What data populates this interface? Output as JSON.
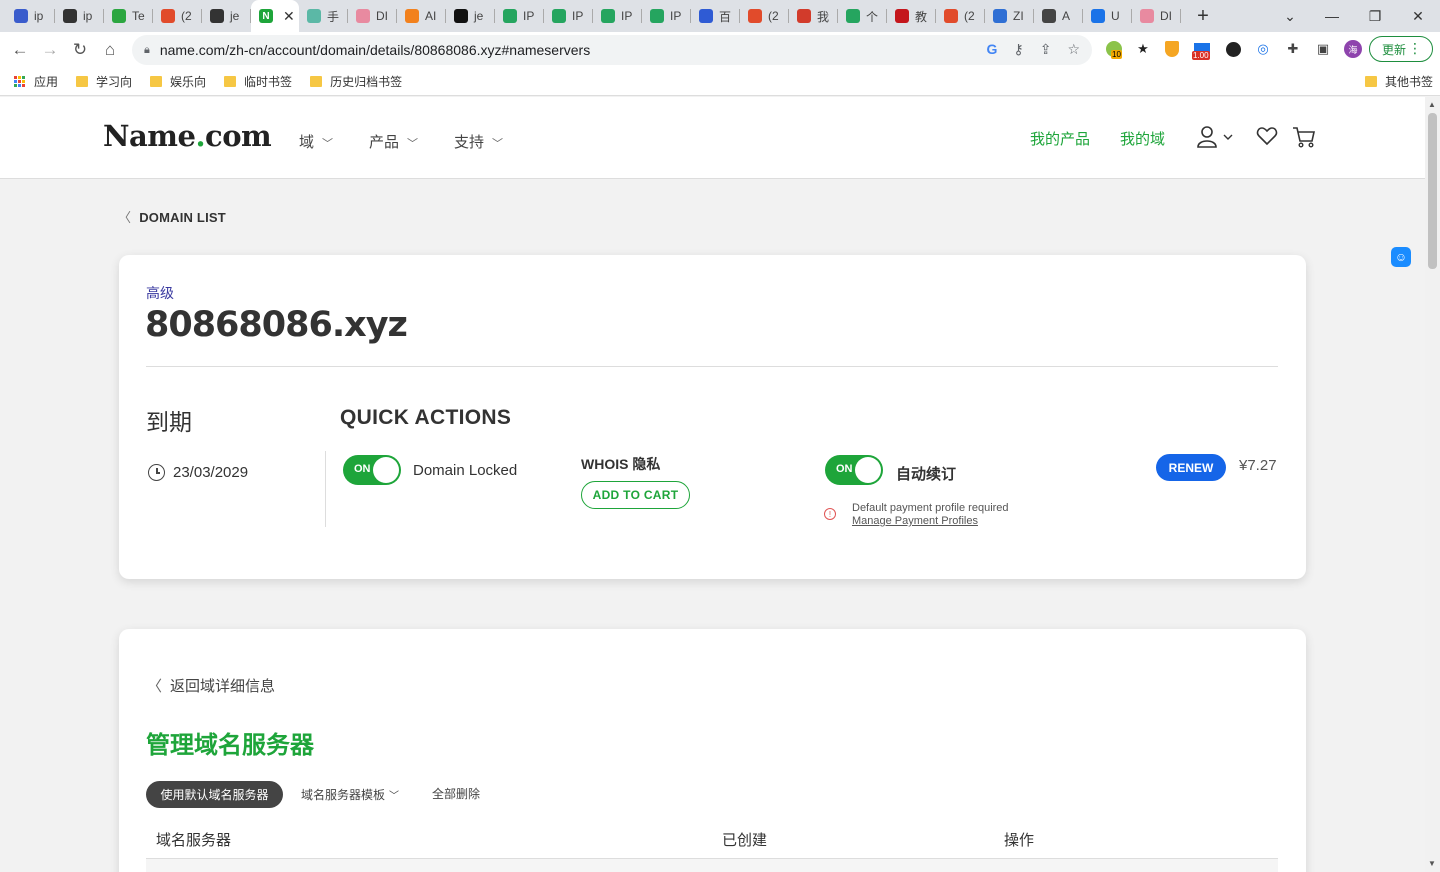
{
  "browser": {
    "tabs": [
      {
        "label": "ip",
        "color": "#3a5ccc"
      },
      {
        "label": "ip",
        "color": "#333333"
      },
      {
        "label": "Te",
        "color": "#2ba640"
      },
      {
        "label": "(2",
        "color": "#e14b2b"
      },
      {
        "label": "je",
        "color": "#333333"
      },
      {
        "label": "",
        "color": "#1ea53a",
        "active": true
      },
      {
        "label": "手",
        "color": "#5bb8a6"
      },
      {
        "label": "DI",
        "color": "#e88aa0"
      },
      {
        "label": "AI",
        "color": "#f2811d"
      },
      {
        "label": "je",
        "color": "#111111"
      },
      {
        "label": "IP",
        "color": "#25a55f"
      },
      {
        "label": "IP",
        "color": "#25a55f"
      },
      {
        "label": "IP",
        "color": "#25a55f"
      },
      {
        "label": "IP",
        "color": "#25a55f"
      },
      {
        "label": "百",
        "color": "#2f5bd4"
      },
      {
        "label": "(2",
        "color": "#e14b2b"
      },
      {
        "label": "我",
        "color": "#d23b2b"
      },
      {
        "label": "个",
        "color": "#25a55f"
      },
      {
        "label": "教",
        "color": "#c4161c"
      },
      {
        "label": "(2",
        "color": "#e14b2b"
      },
      {
        "label": "ZI",
        "color": "#2f6fd4"
      },
      {
        "label": "A",
        "color": "#444444"
      },
      {
        "label": "U",
        "color": "#1a73e8"
      },
      {
        "label": "DI",
        "color": "#e88aa0"
      }
    ],
    "active_tab_icon": "N",
    "close_symbol": "✕",
    "new_tab_symbol": "+",
    "window_controls": {
      "dropdown": "⌄",
      "minimize": "—",
      "restore": "❐",
      "close": "✕"
    },
    "url": "name.com/zh-cn/account/domain/details/80868086.xyz#nameservers",
    "update_button": "更新",
    "extension_badges": {
      "mail": "10",
      "price": "1.00"
    },
    "profile_initial": "海"
  },
  "bookmarks": {
    "apps": "应用",
    "items": [
      "学习向",
      "娱乐向",
      "临时书签",
      "历史归档书签"
    ],
    "other": "其他书签"
  },
  "site": {
    "logo_main": "Name",
    "logo_dot": ".",
    "logo_tld": "com",
    "nav": [
      "域",
      "产品",
      "支持"
    ],
    "my_products": "我的产品",
    "my_domains": "我的域"
  },
  "domain_card": {
    "back_label": "DOMAIN LIST",
    "tier": "高级",
    "domain": "80868086.xyz",
    "expiry_title": "到期",
    "expiry_date": "23/03/2029",
    "quick_actions_title": "QUICK ACTIONS",
    "lock_toggle": "ON",
    "lock_label": "Domain Locked",
    "whois_label": "WHOIS 隐私",
    "add_to_cart": "ADD TO CART",
    "autorenew_toggle": "ON",
    "autorenew_label": "自动续订",
    "payment_warning": "Default payment profile required",
    "payment_link": "Manage Payment Profiles",
    "renew_button": "RENEW",
    "price": "¥7.27"
  },
  "nameserver_card": {
    "back_label": "返回域详细信息",
    "title": "管理域名服务器",
    "use_default": "使用默认域名服务器",
    "template": "域名服务器模板",
    "delete_all": "全部删除",
    "columns": [
      "域名服务器",
      "已创建",
      "操作"
    ]
  },
  "colors": {
    "brand_green": "#1ea53a",
    "renew_blue": "#1565e8",
    "tier_blue": "#3a3aa0"
  }
}
